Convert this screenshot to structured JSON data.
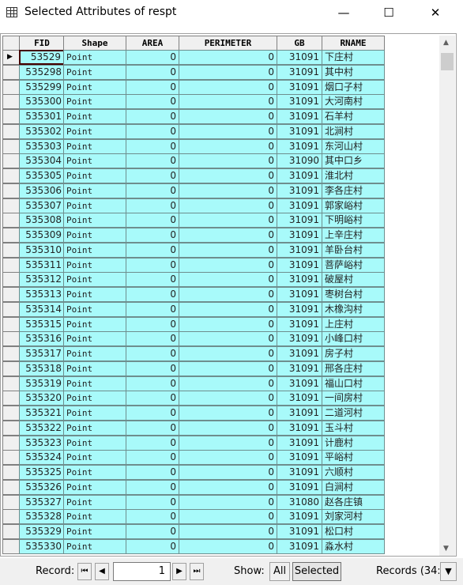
{
  "window": {
    "title": "Selected Attributes of respt",
    "minimize": "—",
    "maximize": "☐",
    "close": "✕"
  },
  "columns": [
    "FID",
    "Shape",
    "AREA",
    "PERIMETER",
    "GB",
    "RNAME"
  ],
  "rows": [
    [
      "53529",
      "Point",
      "0",
      "0",
      "31091",
      "下庄村"
    ],
    [
      "535298",
      "Point",
      "0",
      "0",
      "31091",
      "其中村"
    ],
    [
      "535299",
      "Point",
      "0",
      "0",
      "31091",
      "烟口子村"
    ],
    [
      "535300",
      "Point",
      "0",
      "0",
      "31091",
      "大河南村"
    ],
    [
      "535301",
      "Point",
      "0",
      "0",
      "31091",
      "石羊村"
    ],
    [
      "535302",
      "Point",
      "0",
      "0",
      "31091",
      "北涧村"
    ],
    [
      "535303",
      "Point",
      "0",
      "0",
      "31091",
      "东河山村"
    ],
    [
      "535304",
      "Point",
      "0",
      "0",
      "31090",
      "其中口乡"
    ],
    [
      "535305",
      "Point",
      "0",
      "0",
      "31091",
      "淮北村"
    ],
    [
      "535306",
      "Point",
      "0",
      "0",
      "31091",
      "李各庄村"
    ],
    [
      "535307",
      "Point",
      "0",
      "0",
      "31091",
      "郭家峪村"
    ],
    [
      "535308",
      "Point",
      "0",
      "0",
      "31091",
      "下明峪村"
    ],
    [
      "535309",
      "Point",
      "0",
      "0",
      "31091",
      "上辛庄村"
    ],
    [
      "535310",
      "Point",
      "0",
      "0",
      "31091",
      "羊卧台村"
    ],
    [
      "535311",
      "Point",
      "0",
      "0",
      "31091",
      "菩萨峪村"
    ],
    [
      "535312",
      "Point",
      "0",
      "0",
      "31091",
      "破屋村"
    ],
    [
      "535313",
      "Point",
      "0",
      "0",
      "31091",
      "枣树台村"
    ],
    [
      "535314",
      "Point",
      "0",
      "0",
      "31091",
      "木橡沟村"
    ],
    [
      "535315",
      "Point",
      "0",
      "0",
      "31091",
      "上庄村"
    ],
    [
      "535316",
      "Point",
      "0",
      "0",
      "31091",
      "小峰口村"
    ],
    [
      "535317",
      "Point",
      "0",
      "0",
      "31091",
      "房子村"
    ],
    [
      "535318",
      "Point",
      "0",
      "0",
      "31091",
      "邢各庄村"
    ],
    [
      "535319",
      "Point",
      "0",
      "0",
      "31091",
      "福山口村"
    ],
    [
      "535320",
      "Point",
      "0",
      "0",
      "31091",
      "一间房村"
    ],
    [
      "535321",
      "Point",
      "0",
      "0",
      "31091",
      "二道河村"
    ],
    [
      "535322",
      "Point",
      "0",
      "0",
      "31091",
      "玉斗村"
    ],
    [
      "535323",
      "Point",
      "0",
      "0",
      "31091",
      "计鹿村"
    ],
    [
      "535324",
      "Point",
      "0",
      "0",
      "31091",
      "平峪村"
    ],
    [
      "535325",
      "Point",
      "0",
      "0",
      "31091",
      "六顺村"
    ],
    [
      "535326",
      "Point",
      "0",
      "0",
      "31091",
      "白涧村"
    ],
    [
      "535327",
      "Point",
      "0",
      "0",
      "31080",
      "赵各庄镇"
    ],
    [
      "535328",
      "Point",
      "0",
      "0",
      "31091",
      "刘家河村"
    ],
    [
      "535329",
      "Point",
      "0",
      "0",
      "31091",
      "松口村"
    ],
    [
      "535330",
      "Point",
      "0",
      "0",
      "31091",
      "淼水村"
    ]
  ],
  "footer": {
    "record_label": "Record:",
    "record_value": "1",
    "first": "⏮",
    "prev": "◀",
    "next": "▶",
    "last": "⏭",
    "show_label": "Show:",
    "all": "All",
    "selected": "Selected",
    "records": "Records (34:",
    "dropdown": "▼"
  },
  "colors": {
    "cell": "#a8fafa",
    "header": "#f0f0f0"
  }
}
